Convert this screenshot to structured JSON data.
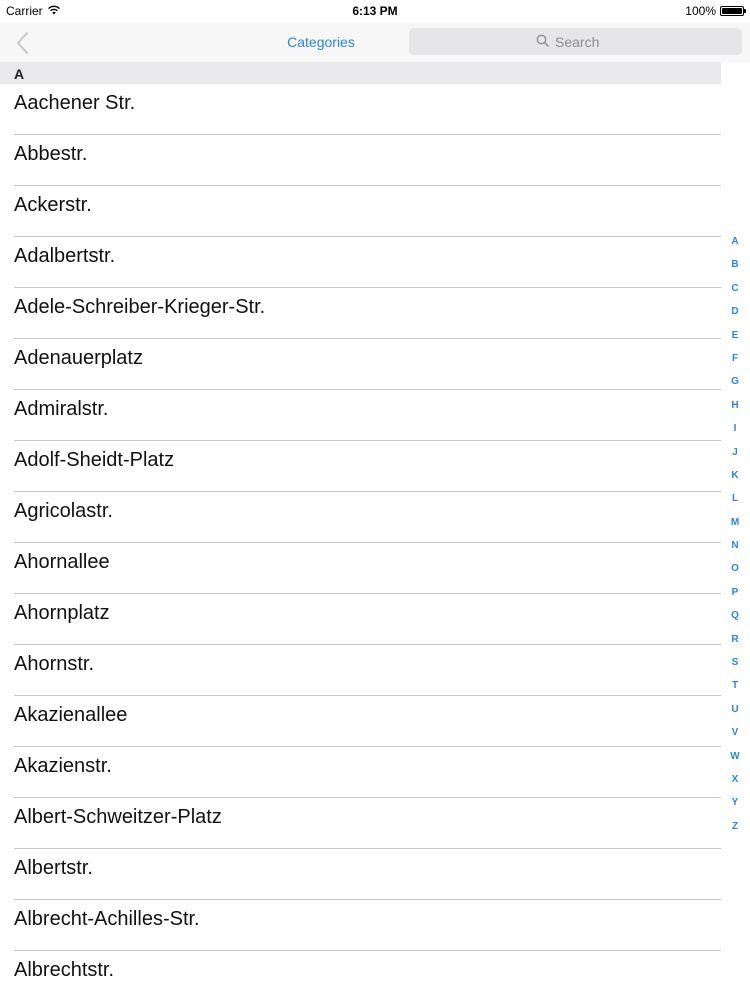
{
  "status_bar": {
    "carrier": "Carrier",
    "time": "6:13 PM",
    "battery": "100%",
    "battery_level": 1.0,
    "wifi_icon": "wifi-icon"
  },
  "nav": {
    "back_icon": "chevron-left-icon",
    "title": "Categories",
    "search_placeholder": "Search",
    "search_icon": "magnifier-icon"
  },
  "colors": {
    "accent": "#2b86d9",
    "section_bg": "#e9e9ec",
    "separator": "#c8c7cc"
  },
  "sections": [
    {
      "header": "A",
      "items": [
        "Aachener Str.",
        "Abbestr.",
        "Ackerstr.",
        "Adalbertstr.",
        "Adele-Schreiber-Krieger-Str.",
        "Adenauerplatz",
        "Admiralstr.",
        "Adolf-Sheidt-Platz",
        "Agricolastr.",
        "Ahornallee",
        "Ahornplatz",
        "Ahornstr.",
        "Akazienallee",
        "Akazienstr.",
        "Albert-Schweitzer-Platz",
        "Albertstr.",
        "Albrecht-Achilles-Str.",
        "Albrechtstr."
      ]
    }
  ],
  "index": [
    "A",
    "B",
    "C",
    "D",
    "E",
    "F",
    "G",
    "H",
    "I",
    "J",
    "K",
    "L",
    "M",
    "N",
    "O",
    "P",
    "Q",
    "R",
    "S",
    "T",
    "U",
    "V",
    "W",
    "X",
    "Y",
    "Z"
  ]
}
